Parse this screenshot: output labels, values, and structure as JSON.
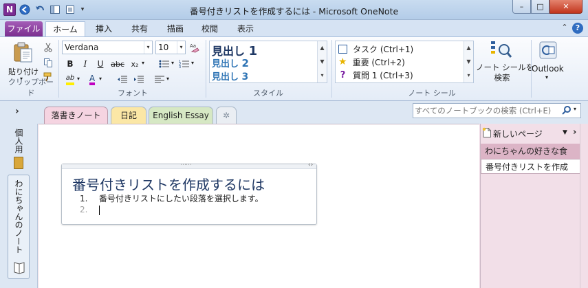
{
  "window": {
    "title": "番号付きリストを作成するには  -  Microsoft OneNote",
    "app_letter": "N",
    "controls": {
      "minimize": "–",
      "maximize": "□",
      "close": "✕"
    }
  },
  "ribbon_tabs": [
    {
      "label": "ファイル"
    },
    {
      "label": "ホーム"
    },
    {
      "label": "挿入"
    },
    {
      "label": "共有"
    },
    {
      "label": "描画"
    },
    {
      "label": "校閲"
    },
    {
      "label": "表示"
    }
  ],
  "help_glyph": "?",
  "collapse_glyph": "⌃",
  "clipboard": {
    "paste_label": "貼り付け",
    "group_label": "クリップボード"
  },
  "font": {
    "family": "Verdana",
    "size": "10",
    "group_label": "フォント",
    "bold": "B",
    "italic": "I",
    "underline": "U",
    "strike": "abc",
    "subscript": "x₂",
    "highlight": "ab",
    "color": "A"
  },
  "styles": {
    "items": [
      {
        "text": "見出し",
        "num": "1"
      },
      {
        "text": "見出し",
        "num": "2"
      },
      {
        "text": "見出し",
        "num": "3"
      }
    ],
    "group_label": "スタイル"
  },
  "tags": {
    "items": [
      {
        "label": "タスク (Ctrl+1)"
      },
      {
        "label": "重要 (Ctrl+2)"
      },
      {
        "label": "質問 1 (Ctrl+3)"
      }
    ],
    "group_label": "ノート シール",
    "find_label_1": "ノート シールを",
    "find_label_2": "検索"
  },
  "outlook": {
    "label": "Outlook"
  },
  "sections": [
    {
      "label": "落書きノート",
      "color": "#f5d4e1"
    },
    {
      "label": "日記",
      "color": "#fbe7a6"
    },
    {
      "label": "English Essay",
      "color": "#d6e8c4"
    }
  ],
  "search": {
    "placeholder": "すべてのノートブックの検索 (Ctrl+E)"
  },
  "notebooks": [
    {
      "label": "個人用"
    },
    {
      "label": "わにちゃんのノート"
    }
  ],
  "expand_glyph": "›",
  "page": {
    "title": "番号付きリストを作成するには",
    "list": [
      {
        "num": "1.",
        "text": "番号付きリストにしたい段落を選択します。"
      },
      {
        "num": "2.",
        "text": ""
      }
    ]
  },
  "pagelist": {
    "new_page": "新しいページ",
    "items": [
      {
        "label": "わにちゃんの好きな食"
      },
      {
        "label": "番号付きリストを作成"
      }
    ]
  },
  "colors": {
    "file_tab": "#8a3aa0",
    "section_active": "#f5d4e1",
    "accent_blue": "#1f497d"
  }
}
